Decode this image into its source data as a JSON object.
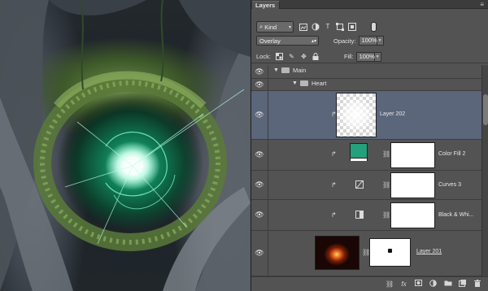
{
  "panel": {
    "tab_label": "Layers",
    "menu_icon": "panel-menu-icon"
  },
  "filter": {
    "kind_label": "Kind",
    "icons": [
      "pixel-filter-icon",
      "adjustment-filter-icon",
      "type-filter-icon",
      "shape-filter-icon",
      "smart-object-filter-icon"
    ]
  },
  "blend": {
    "mode": "Overlay",
    "opacity_label": "Opacity:",
    "opacity_value": "100%"
  },
  "lock": {
    "label": "Lock:",
    "fill_label": "Fill:",
    "fill_value": "100%"
  },
  "layers": [
    {
      "name": "Main",
      "type": "group"
    },
    {
      "name": "Heart",
      "type": "group"
    },
    {
      "name": "Layer 202",
      "type": "pixel",
      "selected": true
    },
    {
      "name": "Color Fill 2",
      "type": "fill",
      "swatch_color": "#23a07c"
    },
    {
      "name": "Curves 3",
      "type": "adjustment"
    },
    {
      "name": "Black & Whi...",
      "type": "adjustment"
    },
    {
      "name": "Layer 201",
      "type": "pixel-masked"
    }
  ],
  "bottom_icons": [
    "link-icon",
    "fx-icon",
    "mask-icon",
    "adjustment-icon",
    "folder-icon",
    "new-layer-icon",
    "trash-icon"
  ],
  "colors": {
    "panel_bg": "#535353",
    "selected_row": "#5b667a",
    "glow": "#2fffb4"
  }
}
